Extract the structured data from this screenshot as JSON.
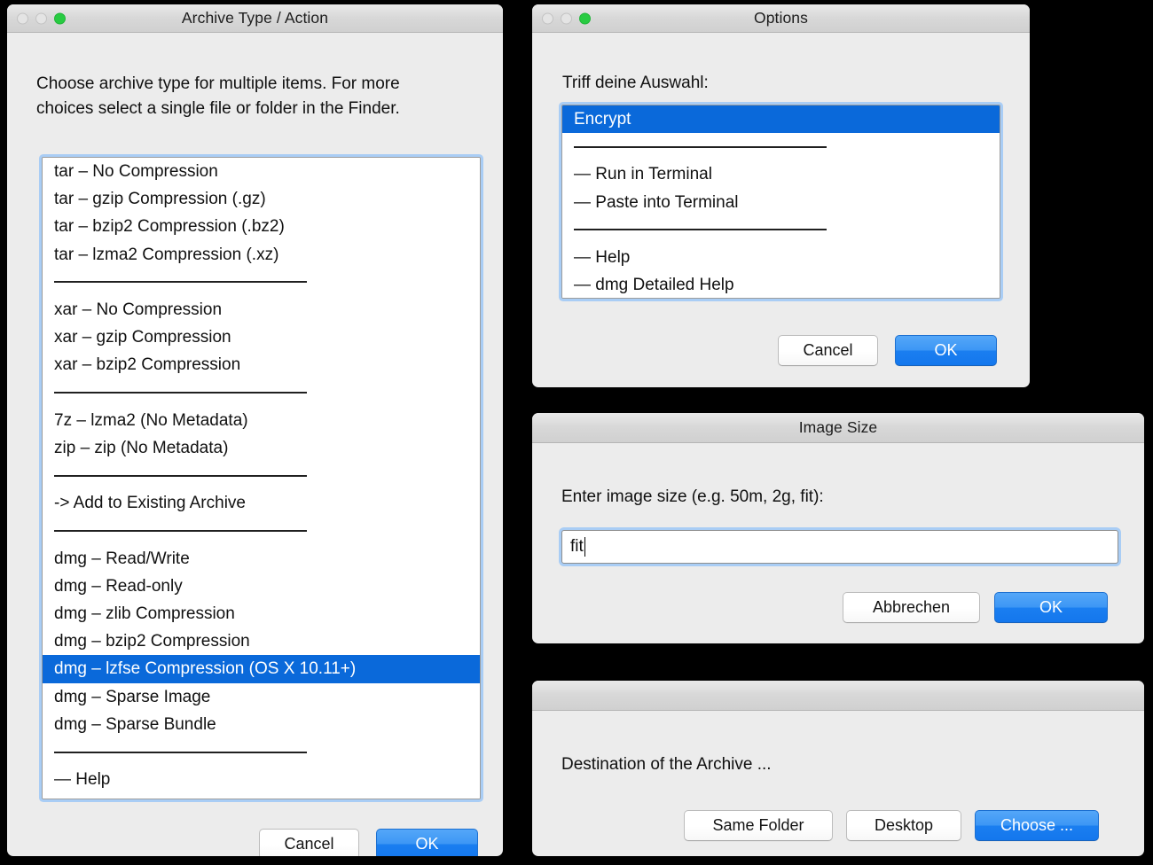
{
  "windows": {
    "archive": {
      "title": "Archive Type / Action",
      "prompt": "Choose archive type for multiple items. For more\nchoices select a single file or folder in the Finder.",
      "list": [
        {
          "label": "tar – No Compression",
          "type": "item"
        },
        {
          "label": "tar – gzip Compression (.gz)",
          "type": "item"
        },
        {
          "label": "tar – bzip2 Compression (.bz2)",
          "type": "item"
        },
        {
          "label": "tar – lzma2 Compression (.xz)",
          "type": "item"
        },
        {
          "label": "",
          "type": "separator"
        },
        {
          "label": "xar – No Compression",
          "type": "item"
        },
        {
          "label": "xar – gzip Compression",
          "type": "item"
        },
        {
          "label": "xar – bzip2 Compression",
          "type": "item"
        },
        {
          "label": "",
          "type": "separator"
        },
        {
          "label": "7z – lzma2 (No Metadata)",
          "type": "item"
        },
        {
          "label": "zip – zip (No Metadata)",
          "type": "item"
        },
        {
          "label": "",
          "type": "separator"
        },
        {
          "label": "-> Add to Existing Archive",
          "type": "item"
        },
        {
          "label": "",
          "type": "separator"
        },
        {
          "label": "dmg – Read/Write",
          "type": "item"
        },
        {
          "label": "dmg – Read-only",
          "type": "item"
        },
        {
          "label": "dmg – zlib Compression",
          "type": "item"
        },
        {
          "label": "dmg – bzip2 Compression",
          "type": "item"
        },
        {
          "label": "dmg – lzfse Compression (OS X 10.11+)",
          "type": "item",
          "selected": true
        },
        {
          "label": "dmg – Sparse Image",
          "type": "item"
        },
        {
          "label": "dmg – Sparse Bundle",
          "type": "item"
        },
        {
          "label": "",
          "type": "separator"
        },
        {
          "label": "— Help",
          "type": "item"
        }
      ],
      "buttons": {
        "cancel": "Cancel",
        "ok": "OK"
      }
    },
    "options": {
      "title": "Options",
      "prompt": "Triff deine Auswahl:",
      "list": [
        {
          "label": "Encrypt",
          "type": "item",
          "selected": true
        },
        {
          "label": "",
          "type": "separator"
        },
        {
          "label": "— Run in Terminal",
          "type": "item"
        },
        {
          "label": "— Paste into Terminal",
          "type": "item"
        },
        {
          "label": "",
          "type": "separator"
        },
        {
          "label": "— Help",
          "type": "item"
        },
        {
          "label": "— dmg Detailed Help",
          "type": "item"
        }
      ],
      "buttons": {
        "cancel": "Cancel",
        "ok": "OK"
      }
    },
    "image_size": {
      "title": "Image Size",
      "prompt": "Enter image size (e.g. 50m, 2g, fit):",
      "input": {
        "value": "fit",
        "placeholder": ""
      },
      "buttons": {
        "cancel": "Abbrechen",
        "ok": "OK"
      }
    },
    "destination": {
      "title": "",
      "prompt": "Destination of the Archive ...",
      "buttons": {
        "same_folder": "Same Folder",
        "desktop": "Desktop",
        "choose": "Choose ..."
      }
    }
  },
  "traffic_lights": {
    "close": "close-button",
    "minimize": "minimize-button",
    "zoom": "zoom-button"
  },
  "colors": {
    "selection_blue": "#0a69da",
    "primary_button_blue": "#1a7ef0",
    "focus_ring": "#a9cdf5",
    "window_bg": "#ececec",
    "desktop_bg": "#000000",
    "zoom_green": "#28cb42"
  }
}
